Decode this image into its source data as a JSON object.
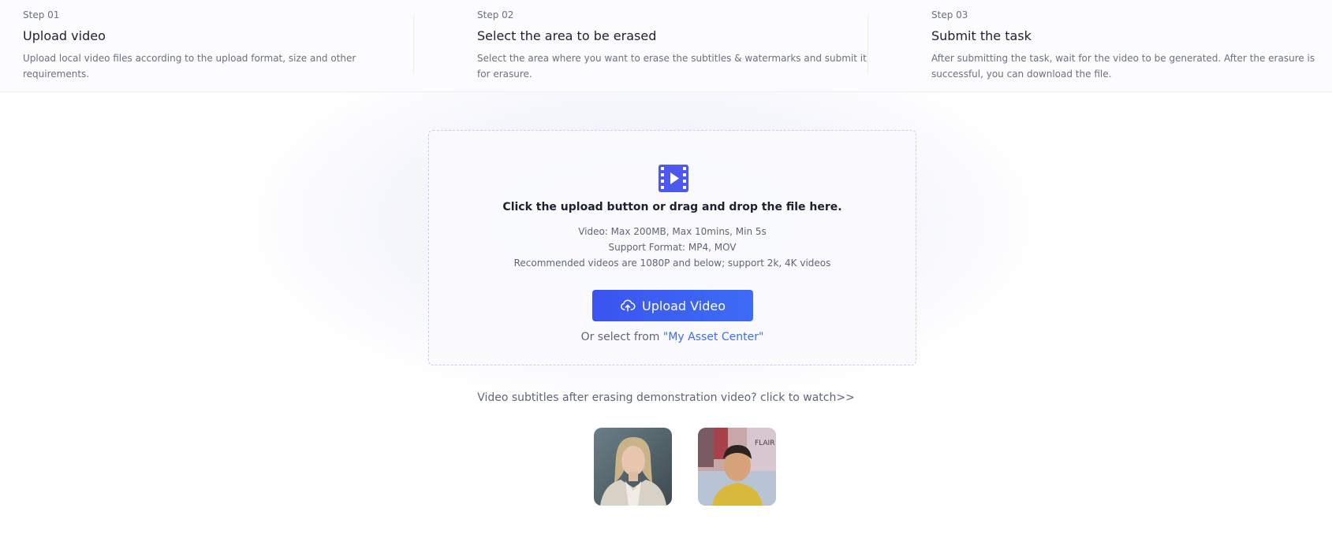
{
  "steps": [
    {
      "number": "Step 01",
      "title": "Upload video",
      "description": "Upload local video files according to the upload format, size and other requirements."
    },
    {
      "number": "Step 02",
      "title": "Select the area to be erased",
      "description": "Select the area where you want to erase the subtitles & watermarks and submit it for erasure."
    },
    {
      "number": "Step 03",
      "title": "Submit the task",
      "description": "After submitting the task, wait for the video to be generated. After the erasure is successful, you can download the file."
    }
  ],
  "upload": {
    "icon": "video-file-icon",
    "heading": "Click the upload button or drag and drop the file here.",
    "requirements": [
      "Video: Max 200MB, Max 10mins, Min 5s",
      "Support Format: MP4, MOV",
      "Recommended videos are 1080P and below; support 2k, 4K videos"
    ],
    "button_label": "Upload Video",
    "button_icon": "cloud-upload-icon",
    "asset_prefix": "Or select from ",
    "asset_link": "\"My Asset Center\""
  },
  "demo": {
    "link_text": "Video subtitles after erasing demonstration video? click to watch>>",
    "thumbnail_2_overlay": "FLAIR"
  },
  "colors": {
    "accent": "#3d6cf5",
    "button_start": "#3b54f0",
    "icon": "#4c58ee"
  }
}
